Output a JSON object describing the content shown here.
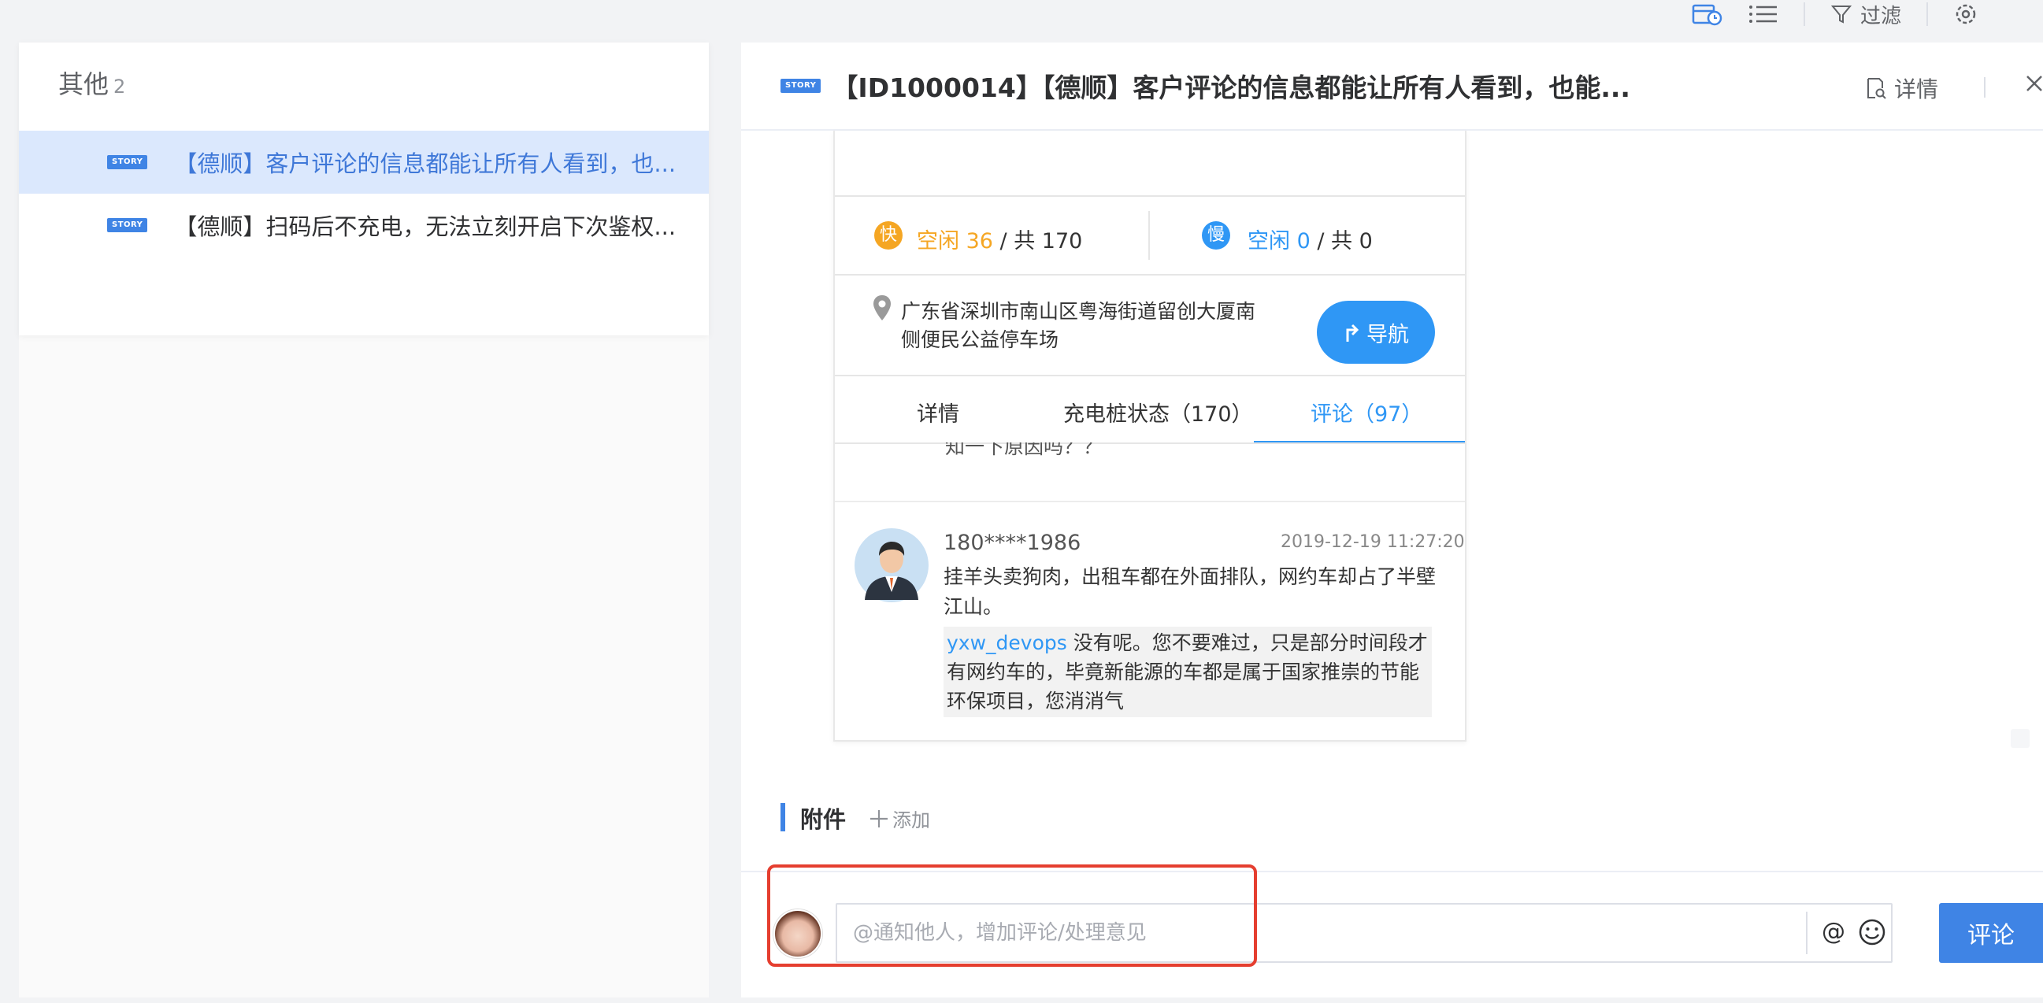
{
  "toolbar": {
    "filter_label": "过滤"
  },
  "left_panel": {
    "group_title": "其他",
    "group_count": "2",
    "items": [
      {
        "tag": "STORY",
        "label": "【德顺】客户评论的信息都能让所有人看到，也...",
        "active": true
      },
      {
        "tag": "STORY",
        "label": "【德顺】扫码后不充电，无法立刻开启下次鉴权...",
        "active": false
      }
    ]
  },
  "detail": {
    "tag": "STORY",
    "title": "【ID1000014】【德顺】客户评论的信息都能让所有人看到，也能...",
    "detail_label": "详情"
  },
  "screenshot": {
    "fast": {
      "badge": "快",
      "free": "空闲 36",
      "total": " / 共 170"
    },
    "slow": {
      "badge": "慢",
      "free": "空闲 0",
      "total": " / 共 0"
    },
    "address": "广东省深圳市南山区粤海街道留创大厦南侧便民公益停车场",
    "nav_label": "导航",
    "tabs": [
      "详情",
      "充电桩状态（170）",
      "评论（97）"
    ],
    "cut_text": "知一下原因吗？？",
    "comment": {
      "user": "180****1986",
      "time": "2019-12-19 11:27:20",
      "body": "挂羊头卖狗肉，出租车都在外面排队，网约车却占了半壁江山。",
      "reply_mention": "yxw_devops",
      "reply_text": " 没有呢。您不要难过，只是部分时间段才有网约车的，毕竟新能源的车都是属于国家推崇的节能环保项目，您消消气"
    }
  },
  "attachments": {
    "label": "附件",
    "add_label": "添加"
  },
  "comment_box": {
    "placeholder": "@通知他人，增加评论/处理意见",
    "value": "",
    "at_symbol": "@",
    "submit_label": "评论"
  },
  "colors": {
    "accent": "#3f84e5",
    "highlight": "#e53e2f",
    "app_blue": "#2f97f5",
    "app_orange": "#f5a623"
  }
}
